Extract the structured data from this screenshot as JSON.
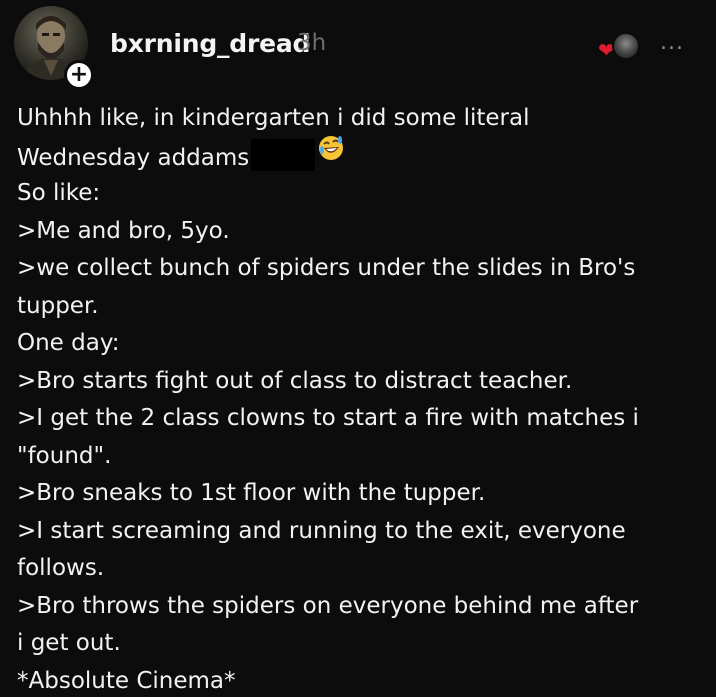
{
  "post": {
    "author": {
      "username": "bxrning_dread",
      "timestamp": "3h",
      "follow_badge": "+"
    },
    "header_icons": {
      "reaction_heart": "heart-icon",
      "reaction_heart_color": "#e21b2e",
      "more_menu": "..."
    },
    "body_lines": [
      "Uhhhh like, in kindergarten i did some literal",
      "Wednesday addams",
      "So like:",
      ">Me and bro, 5yo.",
      ">we collect bunch of spiders under the slides in Bro's",
      "tupper.",
      "One day:",
      ">Bro starts fight out of class to distract teacher.",
      ">I get the 2 class clowns to start a fire with matches i",
      "\"found\".",
      ">Bro sneaks to 1st floor with the tupper.",
      ">I start screaming and running to the exit, everyone",
      "follows.",
      ">Bro throws the spiders on everyone behind me after",
      "i get out.",
      "*Absolute Cinema*"
    ],
    "inline_emoji": "rolling-on-floor-laughing-emoji"
  },
  "theme": {
    "background": "#0c0c0d",
    "text": "#f2f2f2",
    "muted": "#6e6e72"
  }
}
